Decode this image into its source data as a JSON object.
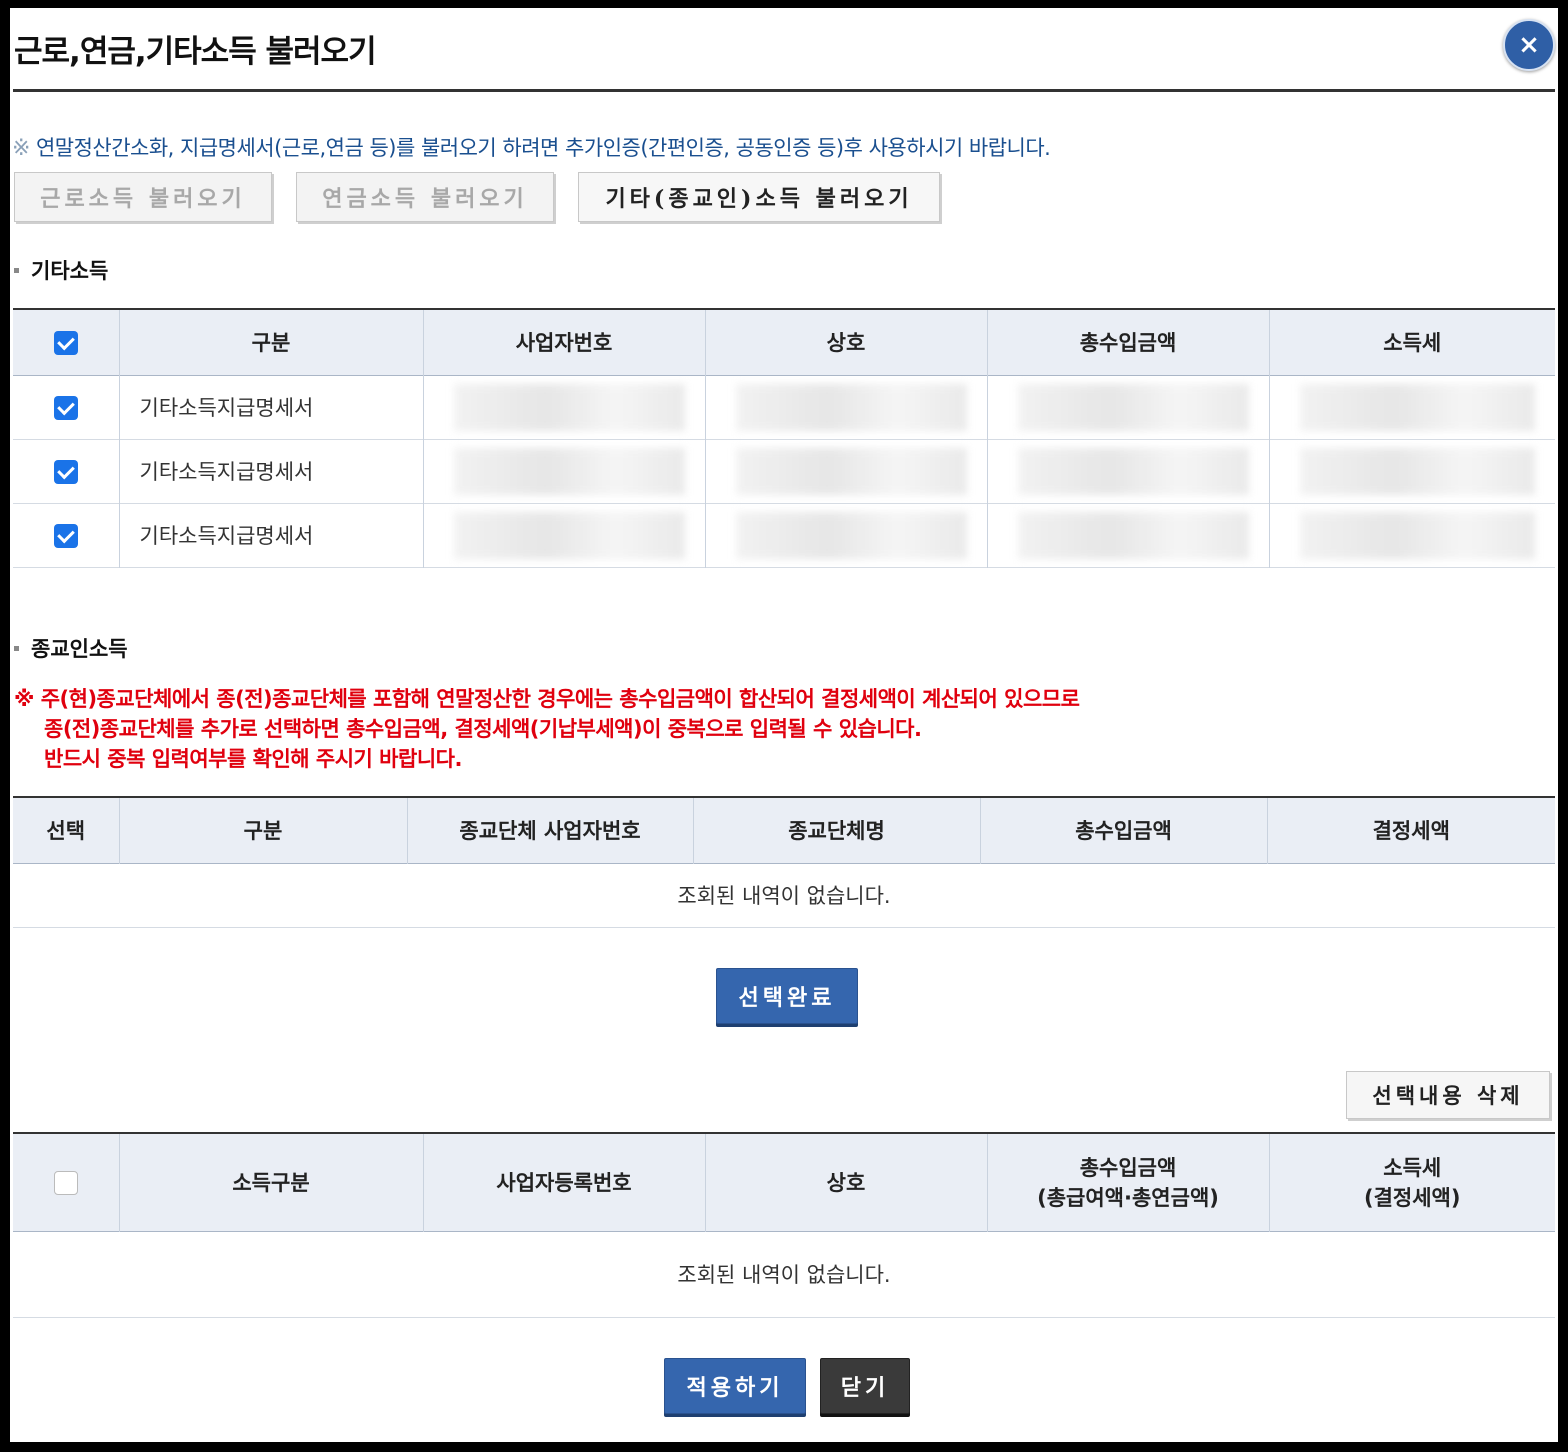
{
  "dialog": {
    "title": "근로,연금,기타소득 불러오기",
    "close_label": "×"
  },
  "notice": {
    "mark": "※",
    "text": "연말정산간소화, 지급명세서(근로,연금 등)를 불러오기 하려면 추가인증(간편인증, 공동인증 등)후 사용하시기 바랍니다."
  },
  "load_buttons": {
    "earned": "근로소득 불러오기",
    "pension": "연금소득 불러오기",
    "other": "기타(종교인)소득 불러오기"
  },
  "other_income": {
    "heading": "기타소득",
    "columns": [
      "구분",
      "사업자번호",
      "상호",
      "총수입금액",
      "소득세"
    ],
    "header_checked": true,
    "rows": [
      {
        "checked": true,
        "type": "기타소득지급명세서"
      },
      {
        "checked": true,
        "type": "기타소득지급명세서"
      },
      {
        "checked": true,
        "type": "기타소득지급명세서"
      }
    ]
  },
  "religious_income": {
    "heading": "종교인소득",
    "warning_lines": [
      "※ 주(현)종교단체에서 종(전)종교단체를 포함해 연말정산한 경우에는 총수입금액이 합산되어 결정세액이 계산되어 있으므로",
      "종(전)종교단체를 추가로 선택하면 총수입금액, 결정세액(기납부세액)이 중복으로 입력될 수 있습니다.",
      "반드시 중복 입력여부를 확인해 주시기 바랍니다."
    ],
    "columns": [
      "선택",
      "구분",
      "종교단체 사업자번호",
      "종교단체명",
      "총수입금액",
      "결정세액"
    ],
    "empty_message": "조회된 내역이 없습니다."
  },
  "select_done_label": "선택완료",
  "delete_selected_label": "선택내용 삭제",
  "result_table": {
    "header_checked": false,
    "columns": [
      "소득구분",
      "사업자등록번호",
      "상호",
      "총수입금액\n(총급여액·총연금액)",
      "소득세\n(결정세액)"
    ],
    "col4_line1": "총수입금액",
    "col4_line2": "(총급여액·총연금액)",
    "col5_line1": "소득세",
    "col5_line2": "(결정세액)",
    "empty_message": "조회된 내역이 없습니다."
  },
  "footer": {
    "apply_label": "적용하기",
    "close_label": "닫기"
  },
  "colors": {
    "accent": "#3566ae",
    "warning": "#e0000e",
    "notice": "#1a4f8f",
    "header_bg": "#eaeef5",
    "checkbox": "#1a73e8"
  }
}
